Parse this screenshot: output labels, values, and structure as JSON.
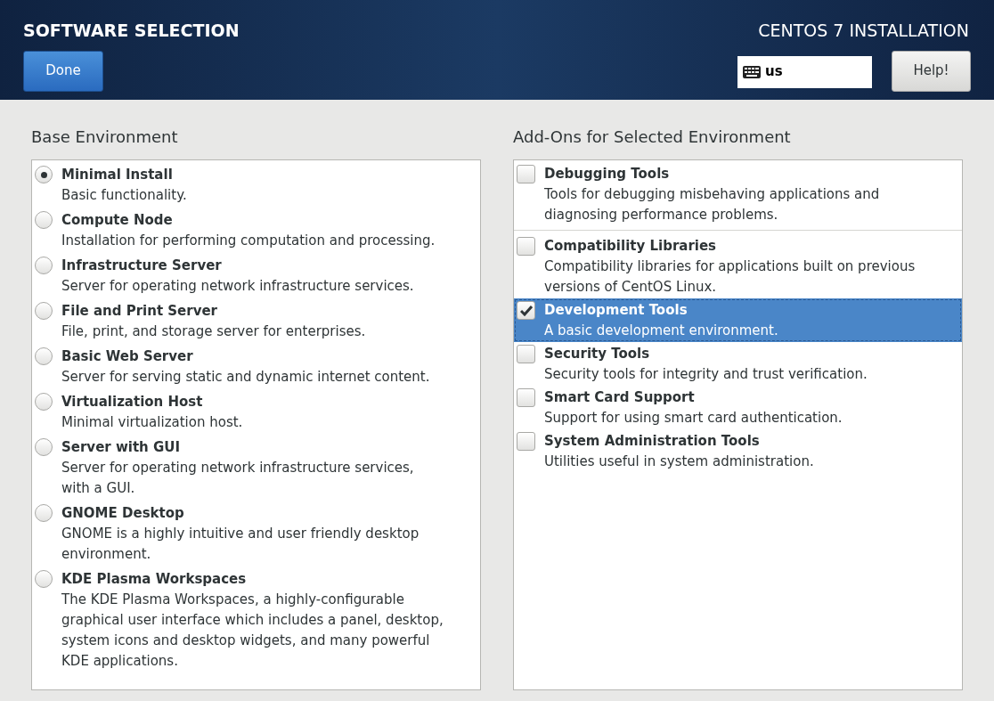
{
  "header": {
    "title": "SOFTWARE SELECTION",
    "done_button": "Done",
    "product": "CENTOS 7 INSTALLATION",
    "keyboard_layout": "us",
    "help_button": "Help!"
  },
  "base_environment": {
    "heading": "Base Environment",
    "items": [
      {
        "name": "Minimal Install",
        "description": "Basic functionality.",
        "selected": true
      },
      {
        "name": "Compute Node",
        "description": "Installation for performing computation and processing.",
        "selected": false
      },
      {
        "name": "Infrastructure Server",
        "description": "Server for operating network infrastructure services.",
        "selected": false
      },
      {
        "name": "File and Print Server",
        "description": "File, print, and storage server for enterprises.",
        "selected": false
      },
      {
        "name": "Basic Web Server",
        "description": "Server for serving static and dynamic internet content.",
        "selected": false
      },
      {
        "name": "Virtualization Host",
        "description": "Minimal virtualization host.",
        "selected": false
      },
      {
        "name": "Server with GUI",
        "description": "Server for operating network infrastructure services, with a GUI.",
        "selected": false
      },
      {
        "name": "GNOME Desktop",
        "description": "GNOME is a highly intuitive and user friendly desktop environment.",
        "selected": false
      },
      {
        "name": "KDE Plasma Workspaces",
        "description": "The KDE Plasma Workspaces, a highly-configurable graphical user interface which includes a panel, desktop, system icons and desktop widgets, and many powerful KDE applications.",
        "selected": false
      }
    ]
  },
  "addons": {
    "heading": "Add-Ons for Selected Environment",
    "items": [
      {
        "name": "Debugging Tools",
        "description": "Tools for debugging misbehaving applications and diagnosing performance problems.",
        "checked": false,
        "selected": false,
        "divider_after": true
      },
      {
        "name": "Compatibility Libraries",
        "description": "Compatibility libraries for applications built on previous versions of CentOS Linux.",
        "checked": false,
        "selected": false,
        "divider_after": false
      },
      {
        "name": "Development Tools",
        "description": "A basic development environment.",
        "checked": true,
        "selected": true,
        "divider_after": false
      },
      {
        "name": "Security Tools",
        "description": "Security tools for integrity and trust verification.",
        "checked": false,
        "selected": false,
        "divider_after": false
      },
      {
        "name": "Smart Card Support",
        "description": "Support for using smart card authentication.",
        "checked": false,
        "selected": false,
        "divider_after": false
      },
      {
        "name": "System Administration Tools",
        "description": "Utilities useful in system administration.",
        "checked": false,
        "selected": false,
        "divider_after": false
      }
    ]
  }
}
